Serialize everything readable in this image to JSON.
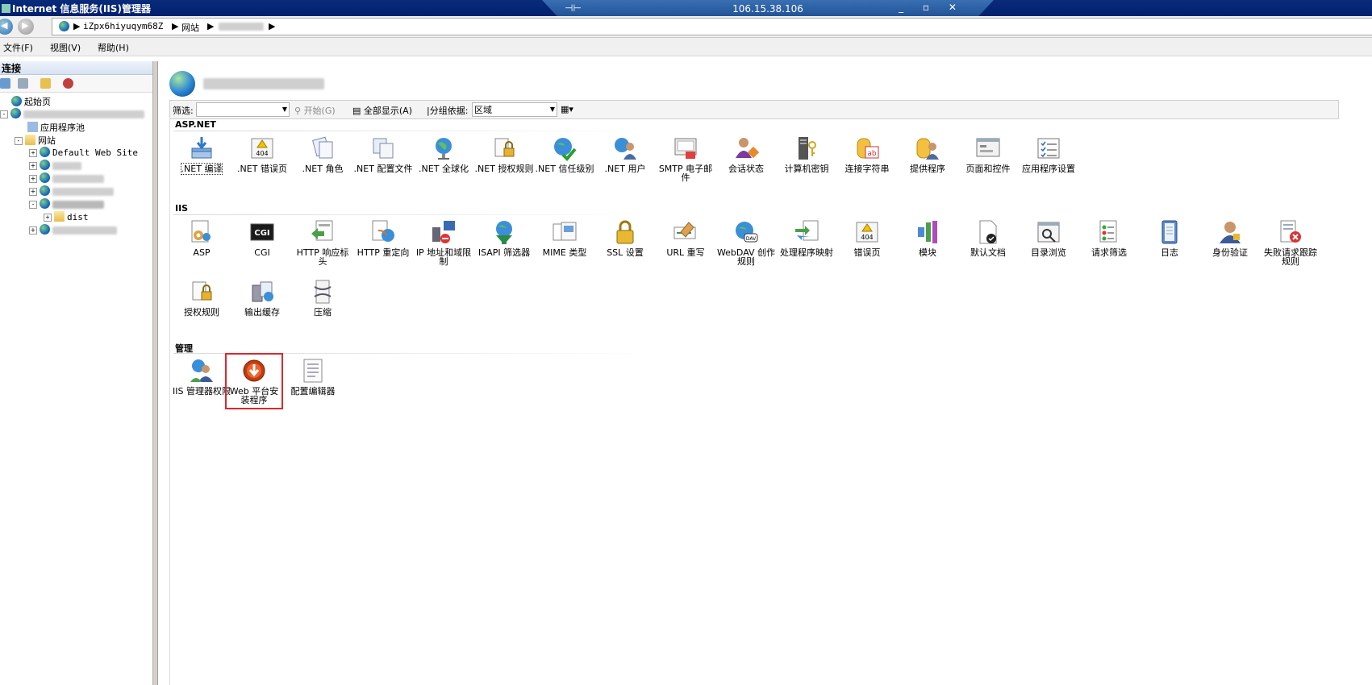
{
  "window": {
    "title": "Internet 信息服务(IIS)管理器",
    "rdp_ip": "106.15.38.106",
    "rdp_pin": "⊣⊢",
    "rdp_controls": "_ ▫ ✕"
  },
  "address": {
    "segments": [
      "iZpx6hiyuqym68Z",
      "网站"
    ],
    "separator": "▶"
  },
  "menu": [
    "文件(F)",
    "视图(V)",
    "帮助(H)"
  ],
  "connections": {
    "title": "连接",
    "tree": {
      "start_page": "起始页",
      "app_pools": "应用程序池",
      "sites": "网站",
      "default_site": "Default Web Site",
      "dist": "dist",
      "expand": "+",
      "collapse": "-"
    }
  },
  "filter": {
    "label": "筛选:",
    "start": "开始(G)",
    "show_all": "全部显示(A)",
    "group_by": "|分组依据:",
    "group_value": "区域"
  },
  "sections": {
    "aspnet": {
      "title": "ASP.NET",
      "items": [
        ".NET 编译",
        ".NET 错误页",
        ".NET 角色",
        ".NET 配置文件",
        ".NET 全球化",
        ".NET 授权规则",
        ".NET 信任级别",
        ".NET 用户",
        "SMTP 电子邮件",
        "会话状态",
        "计算机密钥",
        "连接字符串",
        "提供程序",
        "页面和控件",
        "应用程序设置"
      ]
    },
    "iis": {
      "title": "IIS",
      "items": [
        "ASP",
        "CGI",
        "HTTP 响应标头",
        "HTTP 重定向",
        "IP 地址和域限制",
        "ISAPI 筛选器",
        "MIME 类型",
        "SSL 设置",
        "URL 重写",
        "WebDAV 创作规则",
        "处理程序映射",
        "错误页",
        "模块",
        "默认文档",
        "目录浏览",
        "请求筛选",
        "日志",
        "身份验证",
        "失败请求跟踪规则",
        "授权规则",
        "输出缓存",
        "压缩"
      ]
    },
    "manage": {
      "title": "管理",
      "items": [
        "IIS 管理器权限",
        "Web 平台安装程序",
        "配置编辑器"
      ]
    }
  },
  "icon_text": {
    "error_page_404": "404",
    "cgi": "CGI",
    "dav": "DAV",
    "string": "ab"
  },
  "colors": {
    "selection_outline": "#e0262a",
    "titlebar": "#002070"
  }
}
